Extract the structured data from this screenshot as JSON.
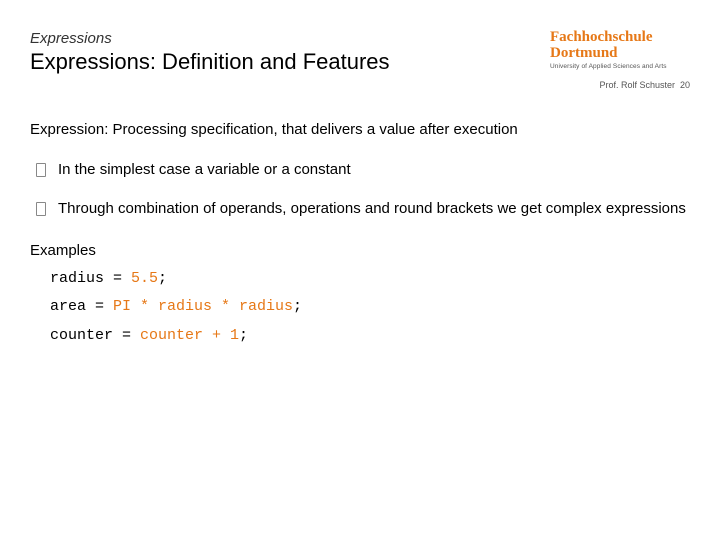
{
  "header": {
    "breadcrumb": "Expressions",
    "title": "Expressions: Definition and Features"
  },
  "logo": {
    "line1": "Fachhochschule",
    "line2": "Dortmund",
    "subtitle": "University of Applied Sciences and Arts"
  },
  "meta": {
    "author": "Prof. Rolf Schuster",
    "page": "20"
  },
  "body": {
    "definition": "Expression: Processing specification, that delivers a value after execution",
    "bullets": [
      "In the simplest case a variable or a constant",
      "Through combination of operands, operations and round brackets we get complex expressions"
    ],
    "examples_label": "Examples",
    "code": {
      "line1_a": "radius = ",
      "line1_b": "5.5",
      "line1_c": ";",
      "line2_a": "area = ",
      "line2_b": "PI * radius * radius",
      "line2_c": ";",
      "line3_a": "counter = ",
      "line3_b": "counter + 1",
      "line3_c": ";"
    }
  }
}
